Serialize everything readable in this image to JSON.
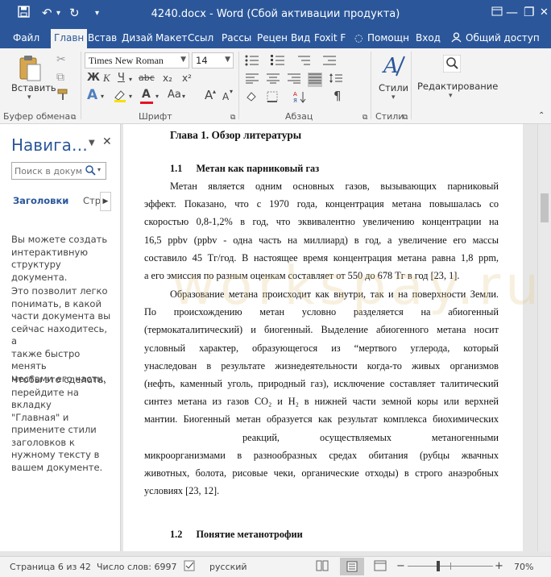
{
  "window": {
    "title": "4240.docx - Word (Сбой активации продукта)",
    "minimize_glyph": "—",
    "restore_glyph": "❐",
    "close_glyph": "✕"
  },
  "quick_access": {
    "save_icon": "save-icon",
    "undo_icon": "undo-icon",
    "redo_icon": "redo-icon"
  },
  "tabs": [
    "Файл",
    "Главн",
    "Встав",
    "Дизай",
    "Макет",
    "Ссыл",
    "Рассы",
    "Рецен",
    "Вид",
    "Foxit F"
  ],
  "active_tab": "Главн",
  "tell_me": "Помощн",
  "sign_in": "Вход",
  "share": "Общий доступ",
  "ribbon": {
    "paste_label": "Вставить",
    "clipboard_group": "Буфер обмена",
    "font_name": "Times New Roman",
    "font_size": "14",
    "bold": "Ж",
    "italic": "К",
    "underline": "Ч",
    "strike": "abc",
    "subscript": "x₂",
    "superscript": "x²",
    "font_group": "Шрифт",
    "paragraph_group": "Абзац",
    "styles_label": "Стили",
    "styles_group": "Стили",
    "editing_label": "Редактирование",
    "font_grow": "A",
    "font_shrink": "A",
    "case_glyph": "Aa",
    "clear_glyph": "A",
    "pilcrow": "¶",
    "text_effect": "A",
    "font_color": "A",
    "highlight_color": "#f7e000",
    "font_color_swatch": "#e81123"
  },
  "nav_pane": {
    "title": "Навига…",
    "search_placeholder": "Поиск в докум",
    "tab_headings": "Заголовки",
    "tab_pages": "Стра",
    "info1": [
      "Вы можете создать",
      "интерактивную",
      "структуру документа."
    ],
    "info2": [
      "Это позволит легко",
      "понимать, в какой",
      "части документа вы",
      "сейчас находитесь, а",
      "также быстро менять",
      "местами его части."
    ],
    "info3": [
      "Чтобы это сделать,",
      "перейдите на вкладку",
      "\"Главная\" и",
      "примените стили",
      "заголовков к",
      "нужному тексту в",
      "вашем документе."
    ]
  },
  "document": {
    "chapter": "Глава 1. Обзор литературы",
    "h1_num": "1.1",
    "h1_text": "Метан как парниковый газ",
    "lines1": [
      "Метан является одним основных газов, вызывающих парниковый",
      "эффект. Показано, что с 1970 года, концентрация метана повышалась со",
      "скоростью 0,8-1,2% в год, что эквивалентно увеличению концентрации на",
      "16,5 ppbv (ppbv - одна часть на миллиард) в год, а увеличение его массы",
      "составило 45 Тг/год. В настоящее время концентрация метана равна 1,8 ppm,",
      "а его эмиссия по разным оценкам составляет от 550 до 678 Тг в год [23, 1]."
    ],
    "lines2": [
      "Образование метана происходит как внутри, так и на поверхности Земли.",
      "По происхождению метан условно разделяется на абиогенный",
      "(термокаталитический) и биогенный. Выделение абиогенного метана носит",
      "условный характер, образующегося из “мертвого углерода, который",
      "унаследован в результате жизнедеятельности когда-то живых организмов",
      "(нефть, каменный уголь, природный газ), исключение составляет талитический",
      "синтез метана из газов CO₂ и H₂ в нижней части земной коры или верхней",
      "мантии. Биогенный метан образуется как результат комплекса биохимических",
      "реакций, осуществляемых метаногенными",
      "микроорганизмами в разнообразных средах обитания (рубцы жвачных",
      "животных, болота, рисовые чеки, органические отходы) в строго анаэробных",
      "условиях [23, 12]."
    ],
    "h2_num": "1.2",
    "h2_text": "Понятие метанотрофии"
  },
  "watermark": "workspay.ru",
  "status": {
    "page": "Страница 6 из 42",
    "words": "Число слов: 6997",
    "language": "русский",
    "zoom_minus": "−",
    "zoom_plus": "+",
    "zoom": "70%"
  }
}
